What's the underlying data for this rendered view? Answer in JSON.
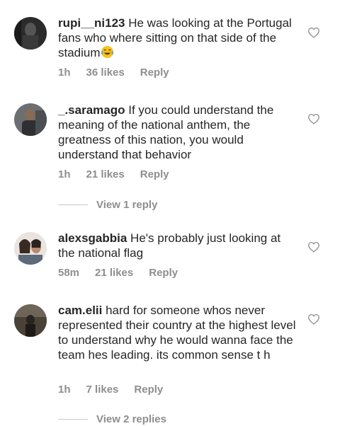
{
  "comments": [
    {
      "username": "rupi__ni123",
      "text": " He was looking at the Portugal fans who where sitting on that side of the stadium",
      "emoji": "😂",
      "time": "1h",
      "likes": "36 likes",
      "reply": "Reply"
    },
    {
      "username": "_.saramago",
      "text": " If you could understand the meaning of the national anthem, the greatness of this nation, you would understand that behavior",
      "time": "1h",
      "likes": "21 likes",
      "reply": "Reply"
    },
    {
      "username": "alexsgabbia",
      "text": " He's probably just looking at the national flag",
      "time": "58m",
      "likes": "21 likes",
      "reply": "Reply"
    },
    {
      "username": "cam.elii",
      "text": " hard for someone whos never represented their country at the highest level to understand why he would wanna face the team hes leading. its common sense t h",
      "time": "1h",
      "likes": "7 likes",
      "reply": "Reply"
    }
  ],
  "view_replies": [
    {
      "label": "View 1 reply"
    },
    {
      "label": "View 2 replies"
    }
  ],
  "icons": {
    "like": "heart-outline-icon",
    "laugh": "face-with-tears-of-joy-icon"
  },
  "colors": {
    "text": "#262626",
    "muted": "#8e8e8e",
    "line": "#c7c7c7"
  }
}
